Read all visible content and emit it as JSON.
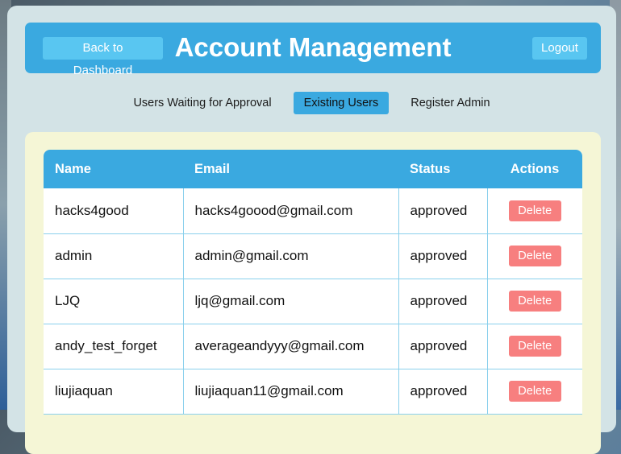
{
  "header": {
    "back_label": "Back to Dashboard",
    "title": "Account Management",
    "logout_label": "Logout"
  },
  "tabs": [
    {
      "label": "Users Waiting for Approval",
      "active": false
    },
    {
      "label": "Existing Users",
      "active": true
    },
    {
      "label": "Register Admin",
      "active": false
    }
  ],
  "table": {
    "columns": [
      "Name",
      "Email",
      "Status",
      "Actions"
    ],
    "rows": [
      {
        "name": "hacks4good",
        "email": "hacks4goood@gmail.com",
        "status": "approved",
        "action": "Delete"
      },
      {
        "name": "admin",
        "email": "admin@gmail.com",
        "status": "approved",
        "action": "Delete"
      },
      {
        "name": "LJQ",
        "email": "ljq@gmail.com",
        "status": "approved",
        "action": "Delete"
      },
      {
        "name": "andy_test_forget",
        "email": "averageandyyy@gmail.com",
        "status": "approved",
        "action": "Delete"
      },
      {
        "name": "liujiaquan",
        "email": "liujiaquan11@gmail.com",
        "status": "approved",
        "action": "Delete"
      }
    ]
  },
  "colors": {
    "accent": "#3aa9e0",
    "button_light": "#59c6f1",
    "delete": "#f77f7f",
    "panel": "#d3e3e6",
    "content": "#f5f6d6"
  }
}
